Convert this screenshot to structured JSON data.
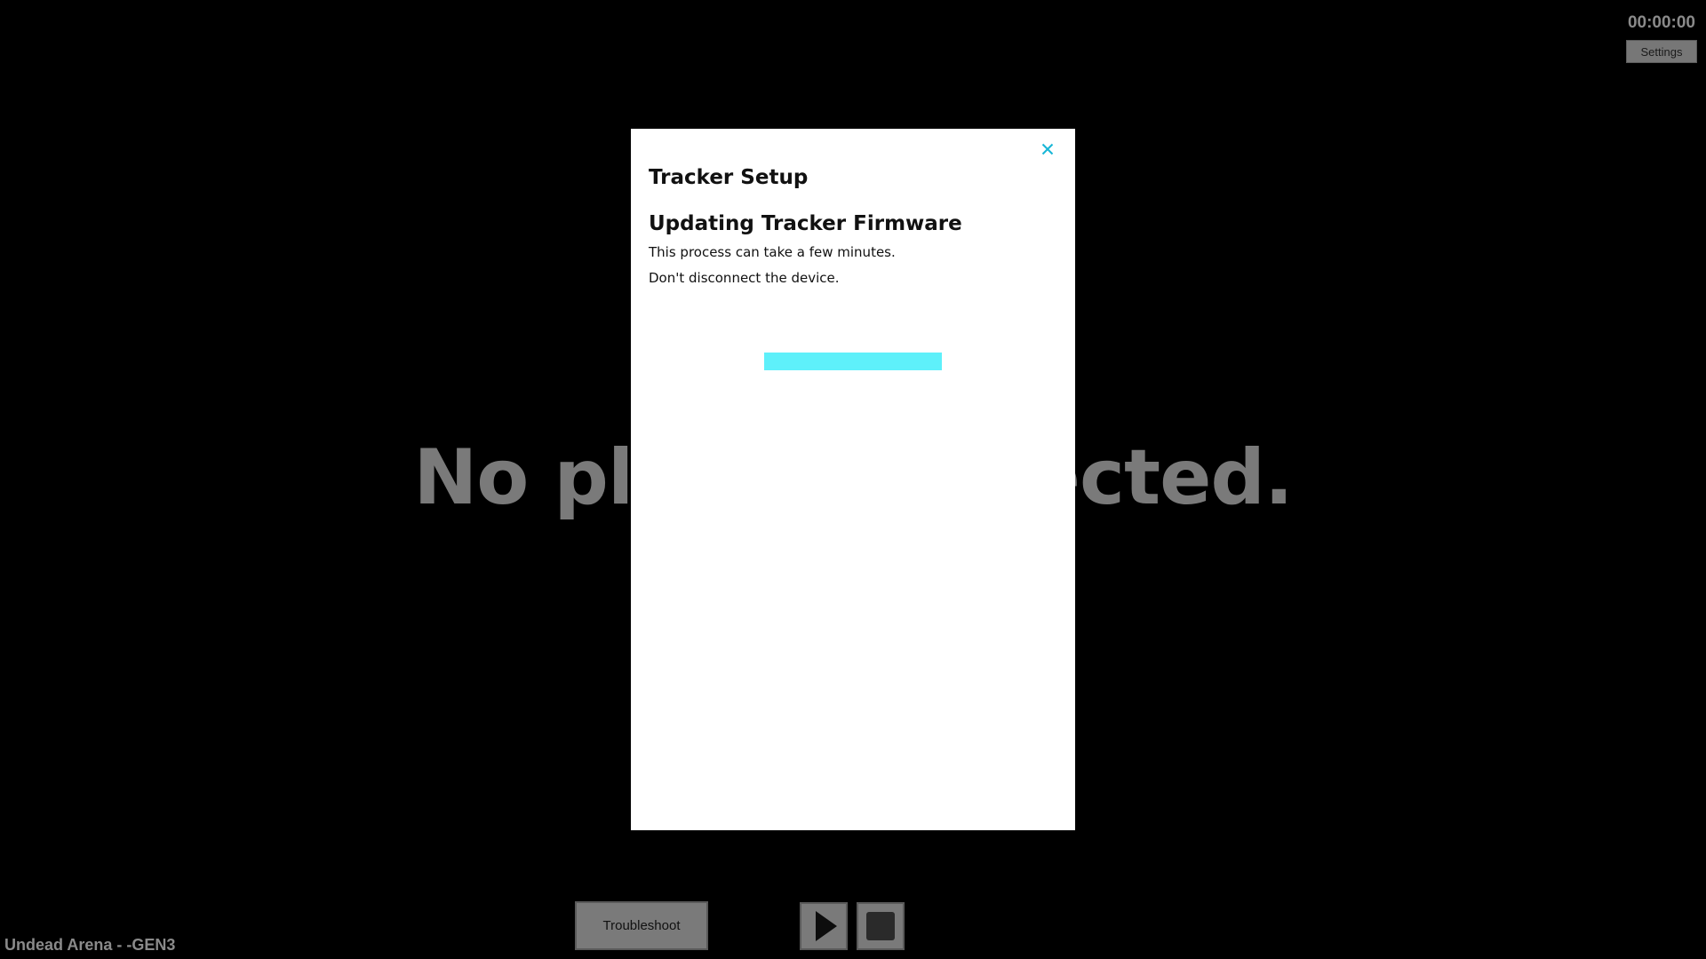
{
  "hud": {
    "timer": "00:00:00",
    "settings_label": "Settings"
  },
  "background_message": "No players detected.",
  "game_label": "Undead Arena - -GEN3",
  "controls": {
    "troubleshoot_label": "Troubleshoot",
    "play_icon": "play-icon",
    "stop_icon": "stop-icon"
  },
  "modal": {
    "title": "Tracker Setup",
    "heading": "Updating Tracker Firmware",
    "line1": "This process can take a few minutes.",
    "line2": "Don't disconnect the device.",
    "close_icon": "close-icon",
    "progress_percent": 100
  },
  "colors": {
    "accent": "#5ef0fa",
    "close": "#17b6d6",
    "background": "#000000",
    "muted_text": "#7a7a7a"
  }
}
